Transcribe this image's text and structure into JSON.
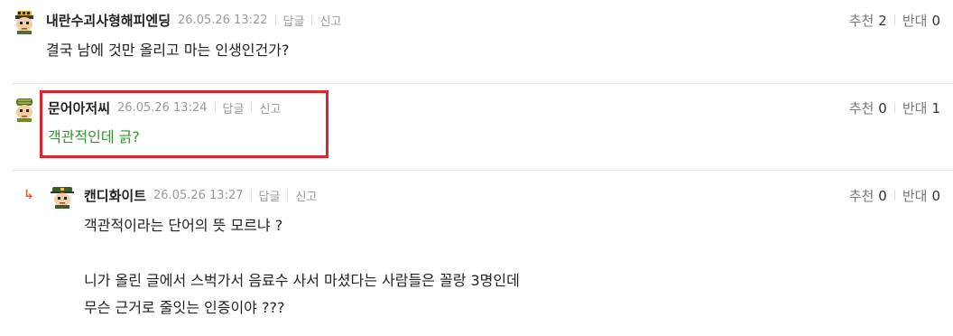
{
  "comments": [
    {
      "author": "내란수괴사형해피엔딩",
      "date": "26.05.26 13:22",
      "reply_label": "답글",
      "report_label": "신고",
      "like_label": "추천",
      "like_count": "2",
      "dislike_label": "반대",
      "dislike_count": "0",
      "text": "결국 남에 것만 올리고 마는 인생인건가?"
    },
    {
      "author": "문어아저씨",
      "date": "26.05.26 13:24",
      "reply_label": "답글",
      "report_label": "신고",
      "like_label": "추천",
      "like_count": "0",
      "dislike_label": "반대",
      "dislike_count": "1",
      "text": "객관적인데 긁?"
    },
    {
      "author": "캔디화이트",
      "date": "26.05.26 13:27",
      "reply_label": "답글",
      "report_label": "신고",
      "like_label": "추천",
      "like_count": "0",
      "dislike_label": "반대",
      "dislike_count": "0",
      "lines": [
        "객관적이라는 단어의 뜻 모르냐 ?",
        "니가 올린 글에서 스벅가서 음료수 사서 마셨다는 사람들은 꼴랑 3명인데",
        "무슨 근거로 줄잇는 인증이야 ???"
      ]
    }
  ],
  "colors": {
    "highlight": "#e0242b",
    "green_text": "#2a9a2a",
    "reply_arrow": "#e8602b"
  },
  "icons": {
    "reply_indicator": "reply-arrow-icon"
  }
}
